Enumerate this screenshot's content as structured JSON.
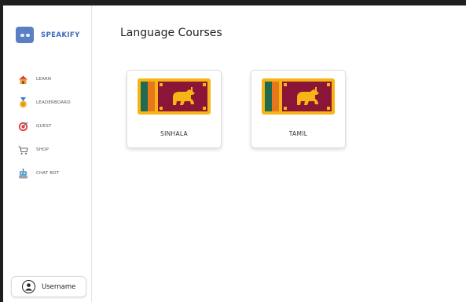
{
  "app": {
    "brand": "SPEAKIFY",
    "accent_color": "#3f68b8"
  },
  "sidebar": {
    "items": [
      {
        "label": "LEARN",
        "icon": "house-icon"
      },
      {
        "label": "LEADERBOARD",
        "icon": "medal-icon"
      },
      {
        "label": "QUEST",
        "icon": "target-icon"
      },
      {
        "label": "SHOP",
        "icon": "cart-icon"
      },
      {
        "label": "CHAT BOT",
        "icon": "robot-icon"
      }
    ],
    "user": {
      "label": "Username",
      "icon": "user-avatar-icon"
    }
  },
  "main": {
    "title": "Language Courses",
    "courses": [
      {
        "label": "SINHALA",
        "icon": "sri-lanka-flag-icon"
      },
      {
        "label": "TAMIL",
        "icon": "sri-lanka-flag-icon"
      }
    ]
  }
}
